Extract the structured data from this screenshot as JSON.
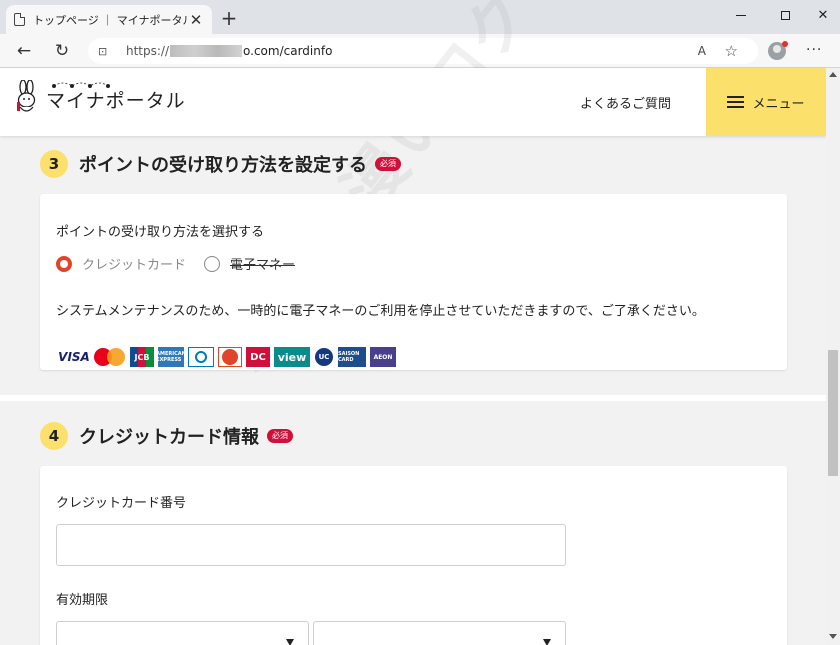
{
  "browser": {
    "tab_title": "トップページ ｜ マイナポータル",
    "tab_close": "✕",
    "new_tab": "+",
    "url_prefix": "https://",
    "url_suffix": "o.com/cardinfo",
    "read_aloud": "A̅",
    "favorite": "☆",
    "more": "···"
  },
  "header": {
    "logo_text": "マイナポータル",
    "faq": "よくあるご質問",
    "menu": "メニュー"
  },
  "section3": {
    "number": "3",
    "title": "ポイントの受け取り方法を設定する",
    "required": "必須",
    "label": "ポイントの受け取り方法を選択する",
    "options": [
      {
        "label": "クレジットカード",
        "selected": true
      },
      {
        "label": "電子マネー",
        "selected": false,
        "disabled": true
      }
    ],
    "notice": "システムメンテナンスのため、一時的に電子マネーのご利用を停止させていただきますので、ご了承ください。",
    "brands": [
      "VISA",
      "Mastercard",
      "JCB",
      "AMERICAN EXPRESS",
      "Diners Club",
      "Discover",
      "DC",
      "view",
      "UC",
      "SAISON CARD",
      "AEON"
    ]
  },
  "section4": {
    "number": "4",
    "title": "クレジットカード情報",
    "required": "必須",
    "card_number_label": "クレジットカード番号",
    "card_number_value": "",
    "expiry_label": "有効期限",
    "expiry_month": "",
    "expiry_year": ""
  },
  "watermark": "無題な漫いログ",
  "colors": {
    "accent_yellow": "#fbe06b",
    "required_red": "#d0103a",
    "radio_orange": "#e0442a"
  }
}
